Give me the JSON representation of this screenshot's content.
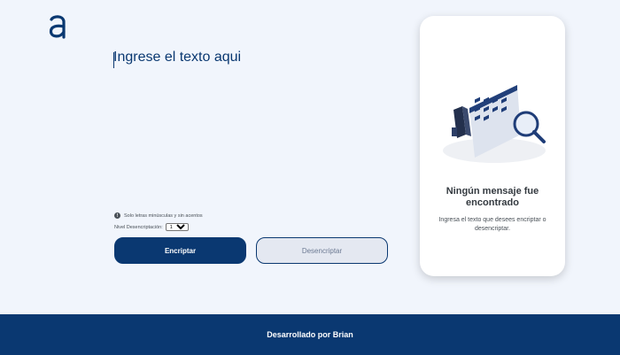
{
  "header": {
    "logo_icon": "alura-a-logo-icon"
  },
  "editor": {
    "placeholder": "Ingrese el texto aqui"
  },
  "hint": {
    "icon": "info-icon",
    "text": "Solo letras minúsculas y sin acentos"
  },
  "level": {
    "label": "Nivel Desencriptación:",
    "selected": "1"
  },
  "buttons": {
    "encrypt_label": "Encriptar",
    "decrypt_label": "Desencriptar"
  },
  "output_panel": {
    "illustration": "search-documents-illustration",
    "title": "Ningún mensaje fue encontrado",
    "text": "Ingresa el texto que desees encriptar o desencriptar."
  },
  "footer": {
    "text": "Desarrollado por Brian"
  },
  "colors": {
    "primary": "#0a3871",
    "background": "#f1f5fc",
    "panel": "#ffffff"
  }
}
